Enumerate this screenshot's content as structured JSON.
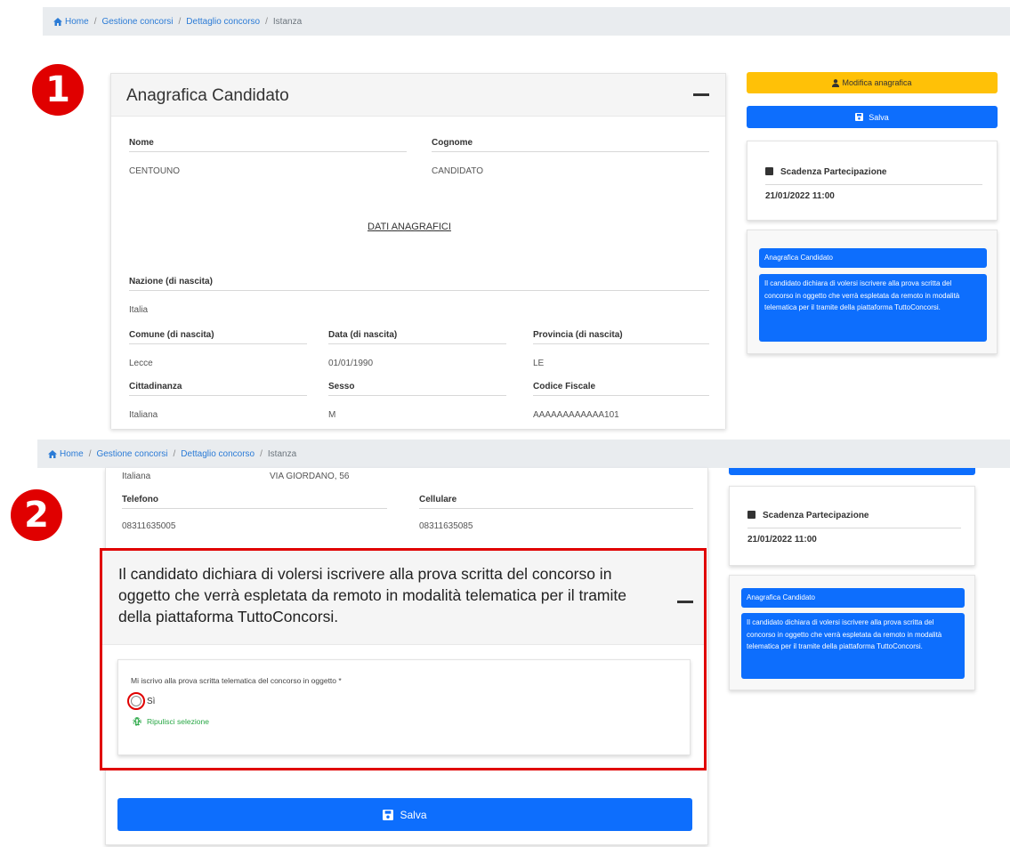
{
  "breadcrumb": {
    "items": [
      "Home",
      "Gestione concorsi",
      "Dettaglio concorso",
      "Istanza"
    ],
    "separator": "/"
  },
  "steps": [
    "1",
    "2"
  ],
  "section1": {
    "card_title": "Anagrafica Candidato",
    "nome_label": "Nome",
    "nome_value": "CENTOUNO",
    "cognome_label": "Cognome",
    "cognome_value": "CANDIDATO",
    "dati_link": "DATI ANAGRAFICI",
    "nazione_label": "Nazione (di nascita)",
    "nazione_value": "Italia",
    "comune_label": "Comune (di nascita)",
    "comune_value": "Lecce",
    "data_label": "Data (di nascita)",
    "data_value": "01/01/1990",
    "provincia_label": "Provincia (di nascita)",
    "provincia_value": "LE",
    "cittadinanza_label": "Cittadinanza",
    "cittadinanza_value": "Italiana",
    "sesso_label": "Sesso",
    "sesso_value": "M",
    "cf_label": "Codice Fiscale",
    "cf_value": "AAAAAAAAAAAA101",
    "btn_modifica": "Modifica anagrafica",
    "btn_salva": "Salva",
    "scadenza_title": "Scadenza Partecipazione",
    "scadenza_value": "21/01/2022 11:00",
    "nav_anagrafica": "Anagrafica Candidato",
    "nav_dichiara": "Il candidato dichiara di volersi iscrivere alla prova scritta del concorso in oggetto che verrà espletata da remoto in modalità telematica per il tramite della piattaforma TuttoConcorsi."
  },
  "section2": {
    "row_cittadinanza": "Italiana",
    "row_indirizzo": "VIA GIORDANO, 56",
    "telefono_label": "Telefono",
    "telefono_value": "08311635005",
    "cellulare_label": "Cellulare",
    "cellulare_value": "08311635085",
    "declaration_title": "Il candidato dichiara di volersi iscrivere alla prova scritta del concorso in oggetto che verrà espletata da remoto in modalità telematica per il tramite della piattaforma TuttoConcorsi.",
    "question": "Mi iscrivo alla prova scritta telematica del concorso in oggetto *",
    "option_si": "Sì",
    "clear_selection": "Ripulisci selezione",
    "btn_salva": "Salva",
    "scadenza_title": "Scadenza Partecipazione",
    "scadenza_value": "21/01/2022 11:00",
    "nav_anagrafica": "Anagrafica Candidato",
    "nav_dichiara": "Il candidato dichiara di volersi iscrivere alla prova scritta del concorso in oggetto che verrà espletata da remoto in modalità telematica per il tramite della piattaforma TuttoConcorsi."
  },
  "colors": {
    "accent_blue": "#0d6efd",
    "warning_yellow": "#ffc107",
    "highlight_red": "#e00000",
    "success_green": "#28a745"
  }
}
